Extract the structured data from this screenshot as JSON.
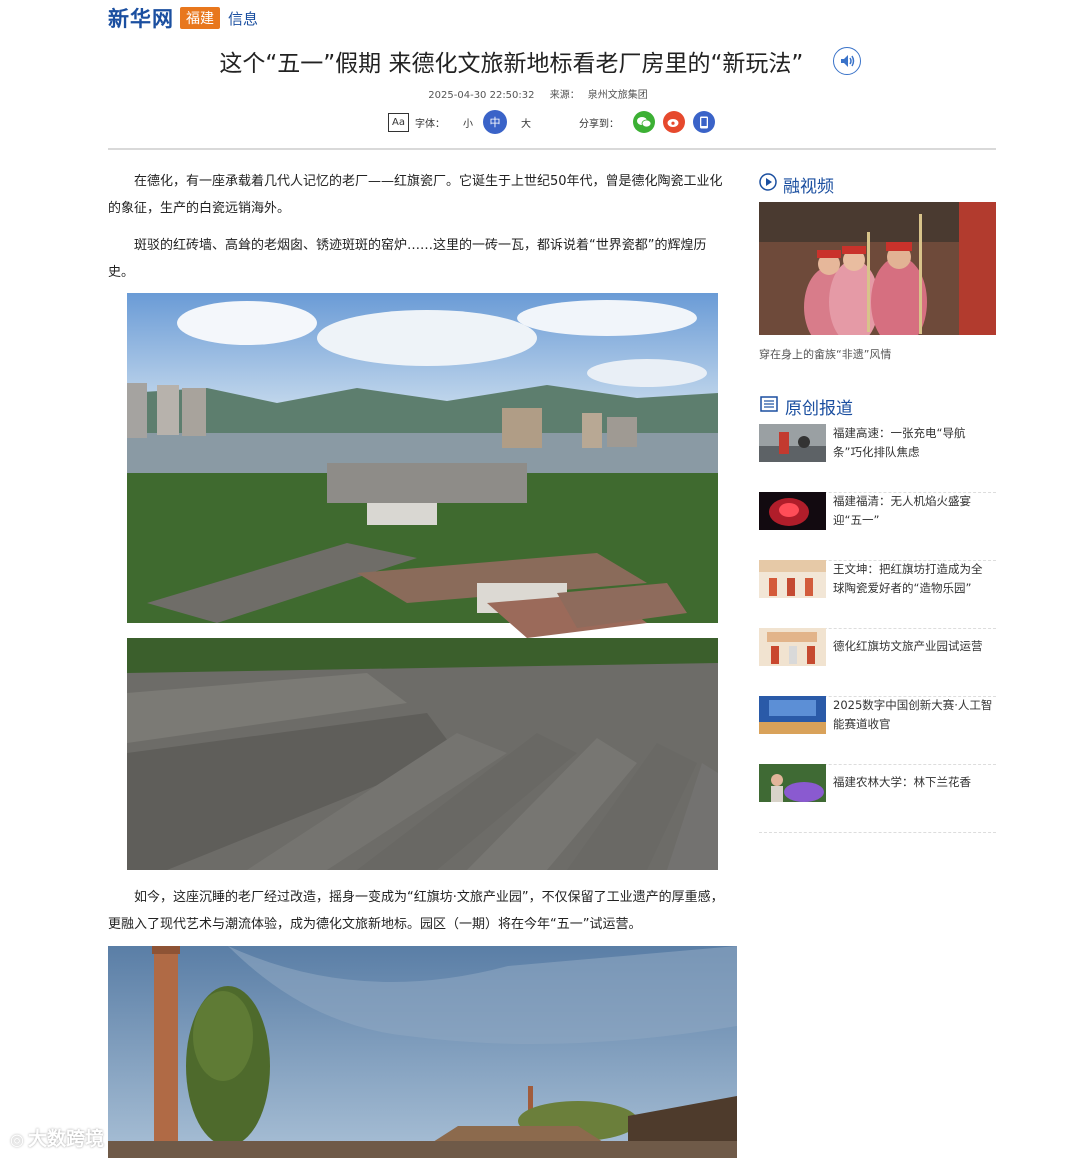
{
  "header": {
    "logo": "新华网",
    "region": "福建",
    "channel": "信息"
  },
  "article": {
    "title": "这个“五一”假期 来德化文旅新地标看老厂房里的“新玩法”",
    "datetime": "2025-04-30 22:50:32",
    "source_label": "来源：",
    "source": "泉州文旅集团",
    "font_label": "字体：",
    "font_small": "小",
    "font_medium": "中",
    "font_large": "大",
    "share_label": "分享到：",
    "paragraphs": [
      "在德化，有一座承载着几代人记忆的老厂——红旗瓷厂。它诞生于上世纪50年代，曾是德化陶瓷工业化的象征，生产的白瓷远销海外。",
      "斑驳的红砖墙、高耸的老烟囱、锈迹斑斑的窑炉……这里的一砖一瓦，都诉说着“世界瓷都”的辉煌历史。",
      "如今，这座沉睡的老厂经过改造，摇身一变成为“红旗坊·文旅产业园”，不仅保留了工业遗产的厚重感，更融入了现代艺术与潮流体验，成为德化文旅新地标。园区（一期）将在今年“五一”试运营。"
    ]
  },
  "sidebar": {
    "video_section": "融视频",
    "video_caption": "穿在身上的畲族“非遗”风情",
    "original_section": "原创报道",
    "news": [
      {
        "title": "福建高速：一张充电“导航条”巧化排队焦虑"
      },
      {
        "title": "福建福清：无人机焰火盛宴迎“五一”"
      },
      {
        "title": "王文坤：把红旗坊打造成为全球陶瓷爱好者的“造物乐园”"
      },
      {
        "title": "德化红旗坊文旅产业园试运营"
      },
      {
        "title": "2025数字中国创新大赛·人工智能赛道收官"
      },
      {
        "title": "福建农林大学：林下兰花香"
      }
    ]
  },
  "watermark": "大数跨境",
  "colors": {
    "brand_blue": "#1b4fa0",
    "region_orange": "#e8771d",
    "accent_blue": "#3a63c8",
    "wechat": "#3cb034",
    "weibo": "#e6492d",
    "mobile": "#3a63c8"
  }
}
